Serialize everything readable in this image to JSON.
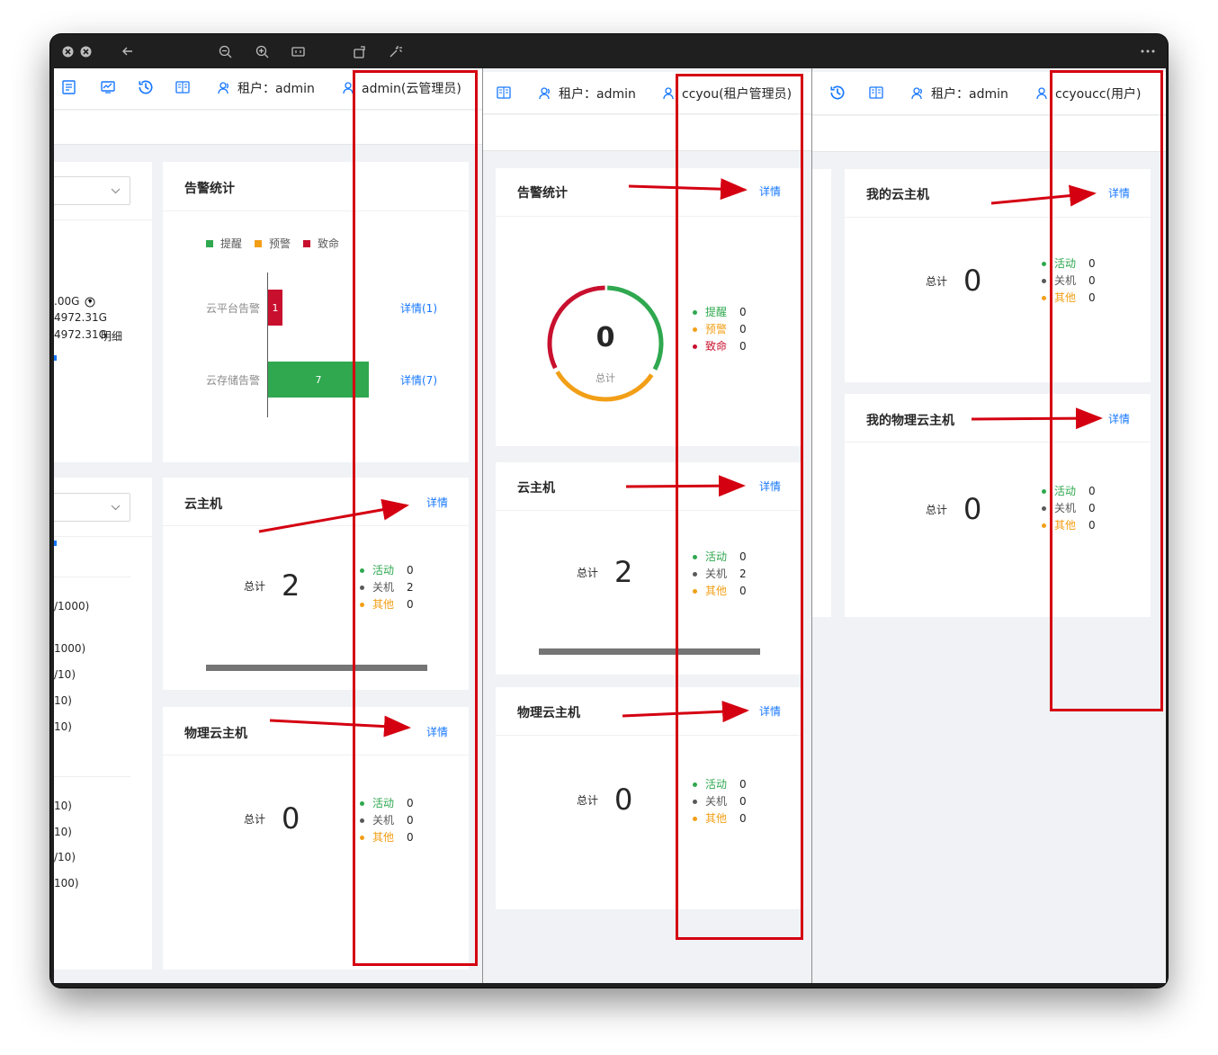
{
  "titlebar": {
    "icons": [
      "close-icon",
      "minimize-icon",
      "back-icon",
      "zoom-out-icon",
      "zoom-in-icon",
      "fit-icon",
      "rotate-icon",
      "magic-icon",
      "more-icon"
    ]
  },
  "header": {
    "tenant_label": "租户：admin",
    "pane1_user": "admin(云管理员)",
    "pane2_user": "ccyou(租户管理员)",
    "pane3_user": "ccyoucc(用户)"
  },
  "pane1": {
    "left_stub": {
      "storage_lines": [
        ".00G",
        "4972.31G",
        "4972.31G"
      ],
      "storage_detail_link": "明细",
      "quota_lines": [
        "/1000)",
        "1000)",
        "/10)",
        "10)",
        "10)",
        "10)",
        "10)",
        "/10)",
        "100)"
      ]
    },
    "alarm": {
      "title": "告警统计",
      "legend": [
        "提醒",
        "预警",
        "致命"
      ],
      "rows": [
        {
          "label": "云平台告警",
          "value": 1,
          "detail": "详情(1)",
          "color": "#c8102e"
        },
        {
          "label": "云存储告警",
          "value": 7,
          "detail": "详情(7)",
          "color": "#2fa84f"
        }
      ]
    },
    "vm": {
      "title": "云主机",
      "link": "详情",
      "total_label": "总计",
      "total": "2",
      "legend": [
        {
          "name": "活动",
          "value": "0",
          "color": "green"
        },
        {
          "name": "关机",
          "value": "2",
          "color": "gray"
        },
        {
          "name": "其他",
          "value": "0",
          "color": "orange"
        }
      ]
    },
    "pm": {
      "title": "物理云主机",
      "link": "详情",
      "total_label": "总计",
      "total": "0",
      "legend": [
        {
          "name": "活动",
          "value": "0",
          "color": "green"
        },
        {
          "name": "关机",
          "value": "0",
          "color": "gray"
        },
        {
          "name": "其他",
          "value": "0",
          "color": "orange"
        }
      ]
    }
  },
  "pane2": {
    "alarm": {
      "title": "告警统计",
      "link": "详情",
      "total": "0",
      "total_label": "总计",
      "legend": [
        {
          "name": "提醒",
          "value": "0",
          "color": "green"
        },
        {
          "name": "预警",
          "value": "0",
          "color": "orange"
        },
        {
          "name": "致命",
          "value": "0",
          "color": "red"
        }
      ]
    },
    "vm": {
      "title": "云主机",
      "link": "详情",
      "total_label": "总计",
      "total": "2",
      "legend": [
        {
          "name": "活动",
          "value": "0",
          "color": "green"
        },
        {
          "name": "关机",
          "value": "2",
          "color": "gray"
        },
        {
          "name": "其他",
          "value": "0",
          "color": "orange"
        }
      ]
    },
    "pm": {
      "title": "物理云主机",
      "link": "详情",
      "total_label": "总计",
      "total": "0",
      "legend": [
        {
          "name": "活动",
          "value": "0",
          "color": "green"
        },
        {
          "name": "关机",
          "value": "0",
          "color": "gray"
        },
        {
          "name": "其他",
          "value": "0",
          "color": "orange"
        }
      ]
    }
  },
  "pane3": {
    "vm": {
      "title": "我的云主机",
      "link": "详情",
      "total_label": "总计",
      "total": "0",
      "legend": [
        {
          "name": "活动",
          "value": "0",
          "color": "green"
        },
        {
          "name": "关机",
          "value": "0",
          "color": "gray"
        },
        {
          "name": "其他",
          "value": "0",
          "color": "orange"
        }
      ]
    },
    "pm": {
      "title": "我的物理云主机",
      "link": "详情",
      "total_label": "总计",
      "total": "0",
      "legend": [
        {
          "name": "活动",
          "value": "0",
          "color": "green"
        },
        {
          "name": "关机",
          "value": "0",
          "color": "gray"
        },
        {
          "name": "其他",
          "value": "0",
          "color": "orange"
        }
      ]
    }
  },
  "colors": {
    "accent": "#1677ff",
    "green": "#2fa84f",
    "gray": "#595959",
    "orange": "#f29f17",
    "red": "#c8102e",
    "annotation": "#d40011"
  }
}
